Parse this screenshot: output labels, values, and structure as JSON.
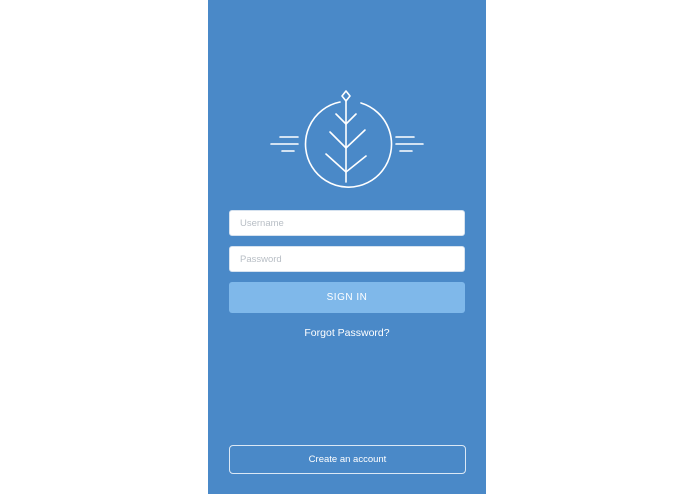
{
  "logo": {
    "icon": "sprout-leaf-icon"
  },
  "form": {
    "username_placeholder": "Username",
    "password_placeholder": "Password",
    "signin_label": "SIGN IN",
    "forgot_label": "Forgot Password?"
  },
  "footer": {
    "create_account_label": "Create an account"
  },
  "colors": {
    "background": "#4a89c8",
    "signin_button": "#7fb8ea",
    "text": "#ffffff"
  }
}
